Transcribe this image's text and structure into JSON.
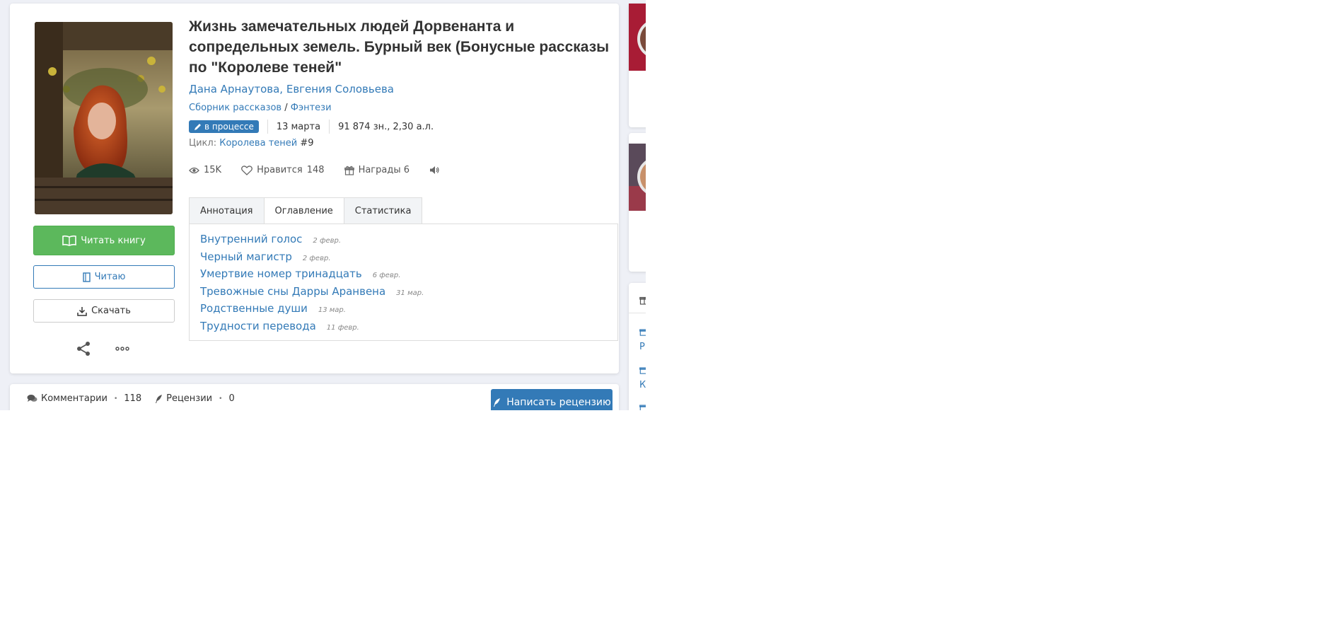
{
  "book": {
    "title": "Жизнь замечательных людей Дорвенанта и сопредельных земель. Бурный век (Бонусные рассказы по \"Королеве теней\"",
    "authors": [
      "Дана Арнаутова",
      "Евгения Соловьева"
    ],
    "author_separator": ",",
    "genres": [
      "Сборник рассказов",
      "Фэнтези"
    ],
    "genre_separator": "/",
    "status": "в процессе",
    "date": "13 марта",
    "size": "91 874 зн., 2,30 а.л.",
    "cycle_label": "Цикл:",
    "cycle_name": "Королева теней",
    "cycle_number": "#9"
  },
  "stats": {
    "views": "15K",
    "likes_label": "Нравится",
    "likes": "148",
    "awards": "Награды 6"
  },
  "buttons": {
    "read": "Читать книгу",
    "reading": "Читаю",
    "download": "Скачать"
  },
  "tabs": [
    "Аннотация",
    "Оглавление",
    "Статистика"
  ],
  "active_tab": "Оглавление",
  "toc": [
    {
      "title": "Внутренний голос",
      "date": "2 февр."
    },
    {
      "title": "Черный магистр",
      "date": "2 февр."
    },
    {
      "title": "Умертвие номер тринадцать",
      "date": "6 февр."
    },
    {
      "title": "Тревожные сны Дарры Аранвена",
      "date": "31 мар."
    },
    {
      "title": "Родственные души",
      "date": "13 мар."
    },
    {
      "title": "Трудности перевода",
      "date": "11 февр."
    }
  ],
  "comments": {
    "comments_label": "Комментарии",
    "comments_count": "118",
    "reviews_label": "Рецензии",
    "reviews_count": "0",
    "write_review": "Написать рецензию"
  },
  "sidebar": {
    "items": [
      "Рі",
      "Ко"
    ]
  },
  "colors": {
    "link": "#337ab7",
    "read_button": "#5cb85c",
    "badge": "#337ab7",
    "page_bg": "#eef0f6"
  }
}
